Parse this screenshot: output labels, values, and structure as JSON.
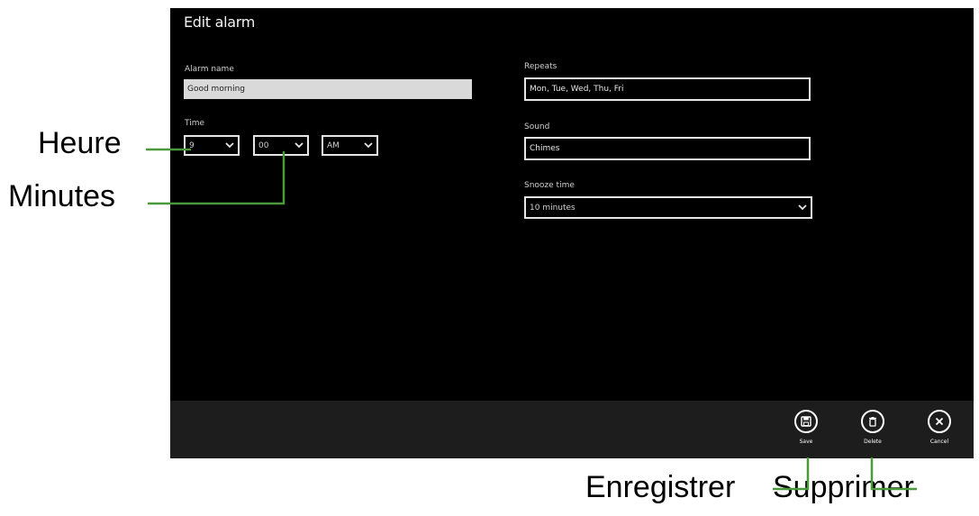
{
  "window": {
    "title": "Edit alarm"
  },
  "form": {
    "alarm_name_label": "Alarm name",
    "alarm_name_value": "Good morning",
    "time_label": "Time",
    "hour_value": "9",
    "minute_value": "00",
    "ampm_value": "AM",
    "repeats_label": "Repeats",
    "repeats_value": "Mon, Tue, Wed, Thu, Fri",
    "sound_label": "Sound",
    "sound_value": "Chimes",
    "snooze_label": "Snooze time",
    "snooze_value": "10 minutes"
  },
  "appbar": {
    "save_label": "Save",
    "delete_label": "Delete",
    "cancel_label": "Cancel"
  },
  "callouts": {
    "hour": "Heure",
    "minutes": "Minutes",
    "save": "Enregistrer",
    "delete": "Supprimer"
  },
  "icons": {
    "save": "floppy-icon",
    "delete": "trash-icon",
    "cancel": "close-icon",
    "dropdown": "chevron-down-icon"
  },
  "colors": {
    "callout_line": "#4a9a3c",
    "screen_bg": "#000000",
    "appbar_bg": "#1d1d1d"
  }
}
